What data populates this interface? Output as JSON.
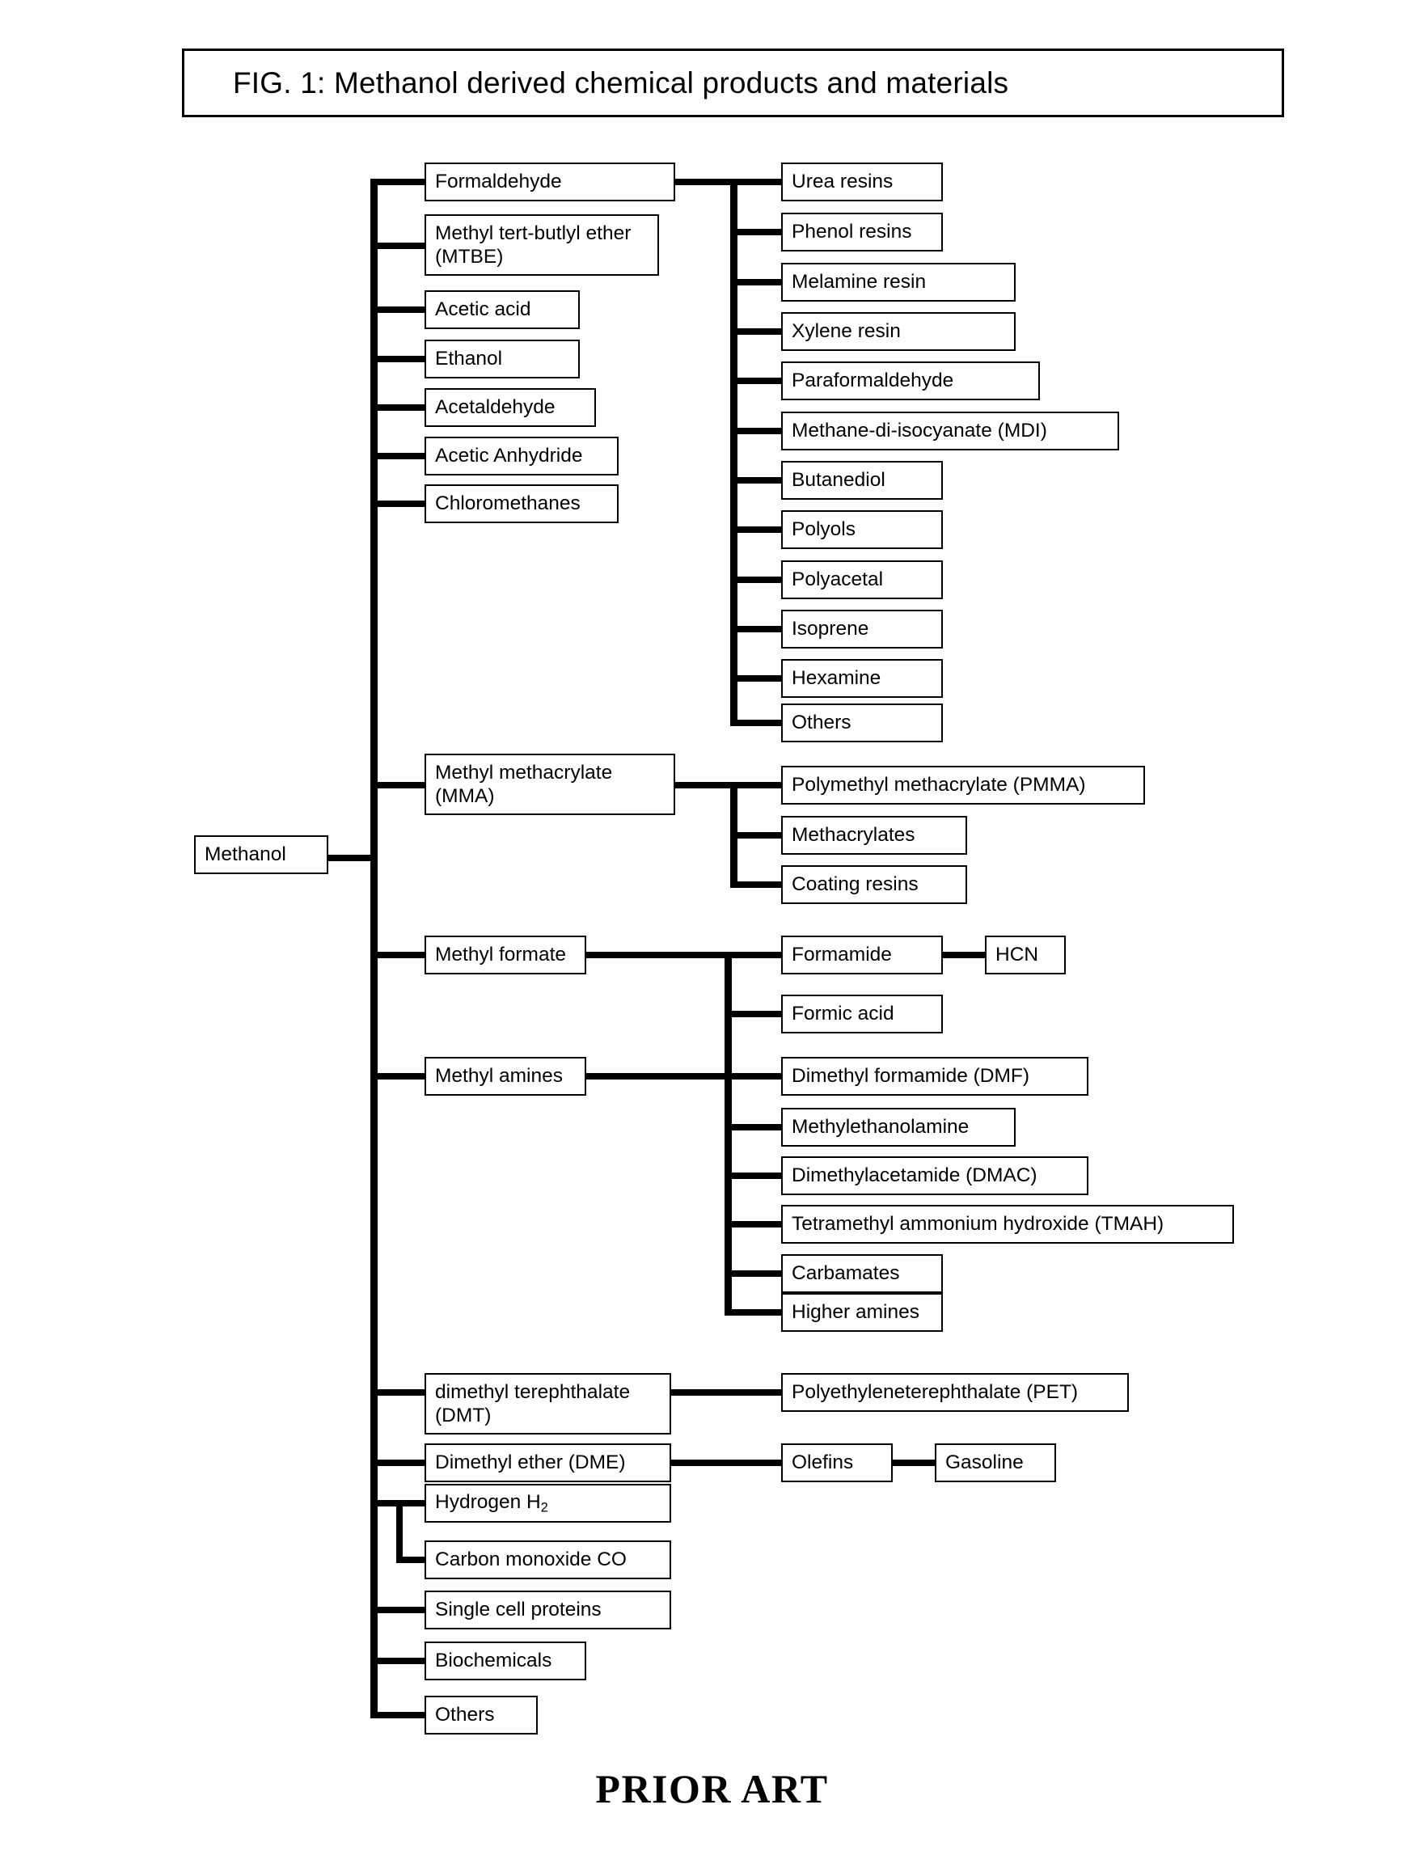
{
  "figure": {
    "title": "FIG. 1: Methanol derived chemical products and materials",
    "footer": "PRIOR ART",
    "ink_color": "#000000",
    "background_color": "#ffffff"
  },
  "root": {
    "label": "Methanol"
  },
  "level1": [
    {
      "label": "Formaldehyde"
    },
    {
      "label": "Methyl tert-butlyl ether\n(MTBE)"
    },
    {
      "label": "Acetic acid"
    },
    {
      "label": "Ethanol"
    },
    {
      "label": "Acetaldehyde"
    },
    {
      "label": "Acetic Anhydride"
    },
    {
      "label": "Chloromethanes"
    },
    {
      "label": "Methyl methacrylate\n(MMA)"
    },
    {
      "label": "Methyl formate"
    },
    {
      "label": "Methyl amines"
    },
    {
      "label": "dimethyl terephthalate\n(DMT)"
    },
    {
      "label": "Dimethyl ether (DME)"
    },
    {
      "label": "Hydrogen H2",
      "label_html": "Hydrogen H<sub>2</sub>"
    },
    {
      "label": "Carbon monoxide CO"
    },
    {
      "label": "Single cell proteins"
    },
    {
      "label": "Biochemicals"
    },
    {
      "label": "Others"
    }
  ],
  "formaldehyde_products": [
    {
      "label": "Urea resins"
    },
    {
      "label": "Phenol resins"
    },
    {
      "label": "Melamine resin"
    },
    {
      "label": "Xylene resin"
    },
    {
      "label": "Paraformaldehyde"
    },
    {
      "label": "Methane-di-isocyanate (MDI)"
    },
    {
      "label": "Butanediol"
    },
    {
      "label": "Polyols"
    },
    {
      "label": "Polyacetal"
    },
    {
      "label": "Isoprene"
    },
    {
      "label": "Hexamine"
    },
    {
      "label": "Others"
    }
  ],
  "mma_products": [
    {
      "label": "Polymethyl methacrylate (PMMA)"
    },
    {
      "label": "Methacrylates"
    },
    {
      "label": "Coating resins"
    }
  ],
  "formate_amine_products": [
    {
      "label": "Formamide"
    },
    {
      "label": "Formic acid"
    },
    {
      "label": "Dimethyl formamide (DMF)"
    },
    {
      "label": "Methylethanolamine"
    },
    {
      "label": "Dimethylacetamide (DMAC)"
    },
    {
      "label": "Tetramethyl ammonium hydroxide (TMAH)"
    },
    {
      "label": "Carbamates"
    },
    {
      "label": "Higher amines"
    }
  ],
  "formamide_products": [
    {
      "label": "HCN"
    }
  ],
  "dmt_products": [
    {
      "label": "Polyethyleneterephthalate (PET)"
    }
  ],
  "dme_products": [
    {
      "label": "Olefins"
    }
  ],
  "olefin_products": [
    {
      "label": "Gasoline"
    }
  ]
}
